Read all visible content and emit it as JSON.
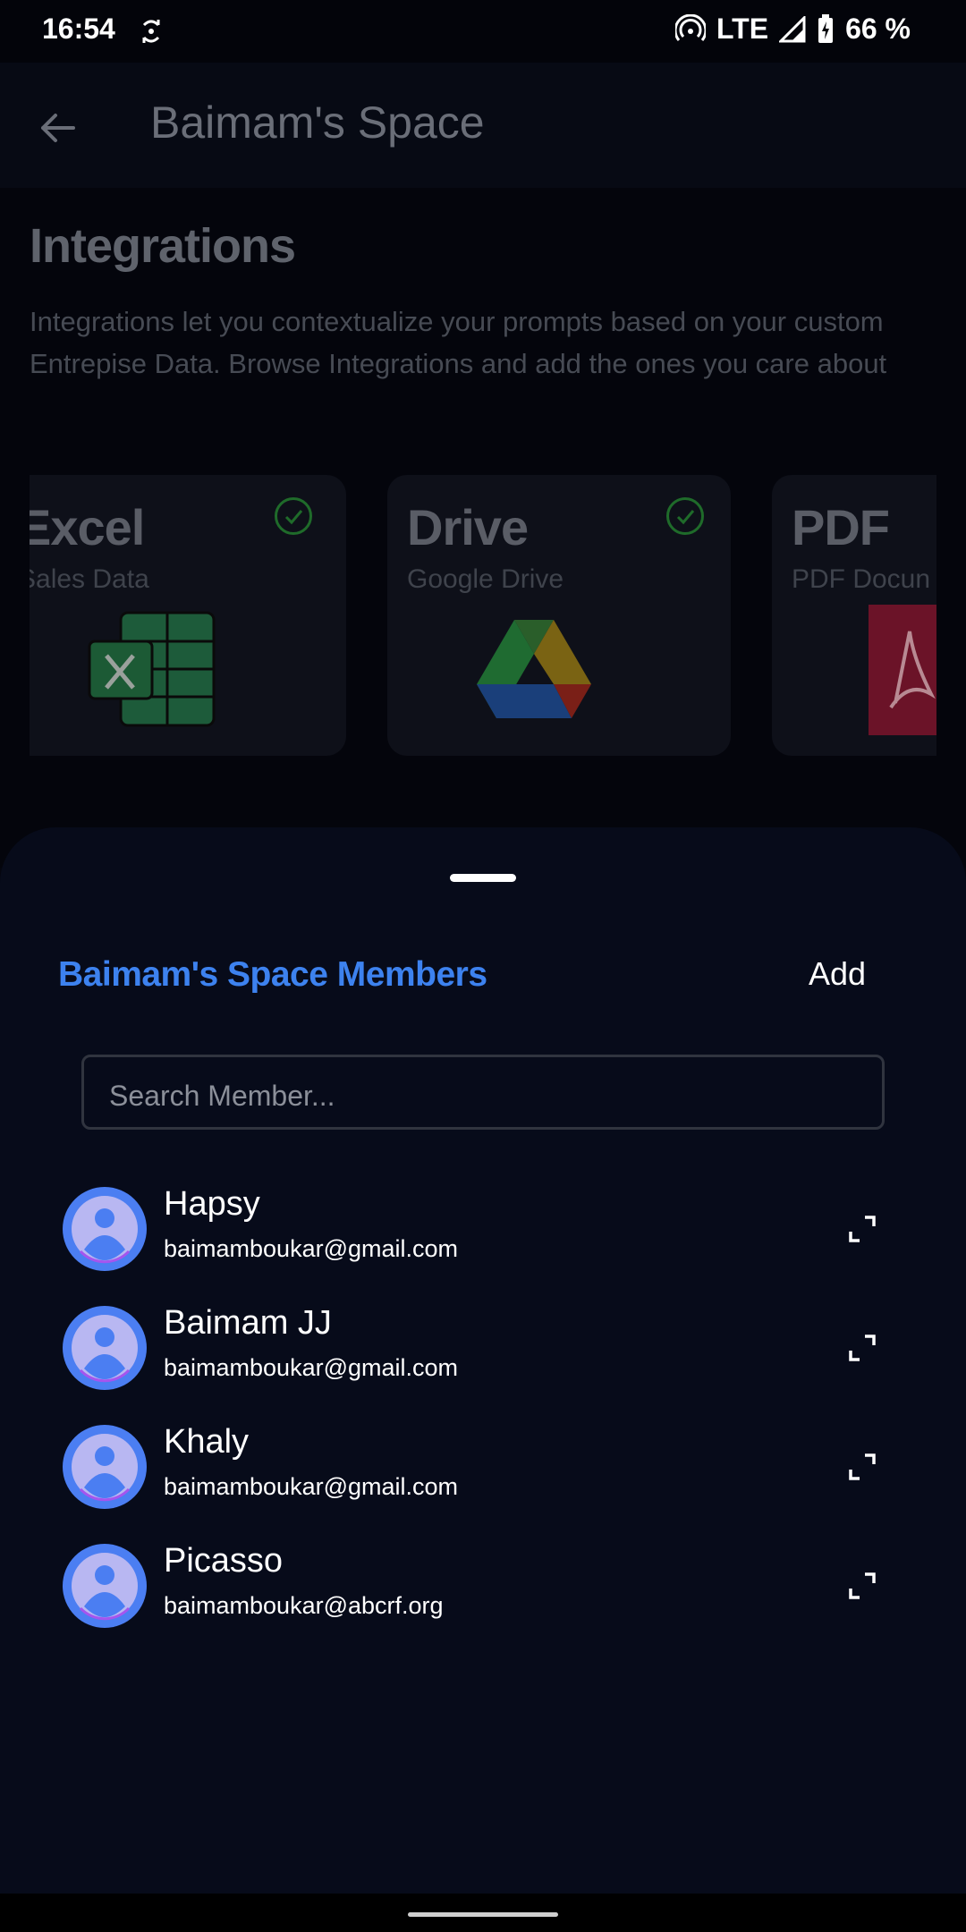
{
  "status": {
    "time": "16:54",
    "network": "LTE",
    "battery": "66 %"
  },
  "appbar": {
    "title": "Baimam's Space"
  },
  "integrations": {
    "title": "Integrations",
    "description": "Integrations let you contextualize your prompts based on your custom Entrepise Data. Browse Integrations and add the ones you care about",
    "cards": [
      {
        "title": "Excel",
        "subtitle": "Sales Data",
        "icon": "excel-icon",
        "connected": true
      },
      {
        "title": "Drive",
        "subtitle": "Google Drive",
        "icon": "google-drive-icon",
        "connected": true
      },
      {
        "title": "PDF",
        "subtitle": "PDF Docun",
        "icon": "pdf-icon",
        "connected": false
      }
    ]
  },
  "sheet": {
    "title": "Baimam's Space Members",
    "add_label": "Add",
    "search_placeholder": "Search Member..."
  },
  "members": [
    {
      "name": "Hapsy",
      "email": "baimamboukar@gmail.com"
    },
    {
      "name": "Baimam JJ",
      "email": "baimamboukar@gmail.com"
    },
    {
      "name": "Khaly",
      "email": "baimamboukar@gmail.com"
    },
    {
      "name": "Picasso",
      "email": "baimamboukar@abcrf.org"
    }
  ],
  "colors": {
    "accent": "#3d82ef",
    "sheet_bg": "#070b1a",
    "avatar": "#4b7ef2"
  }
}
